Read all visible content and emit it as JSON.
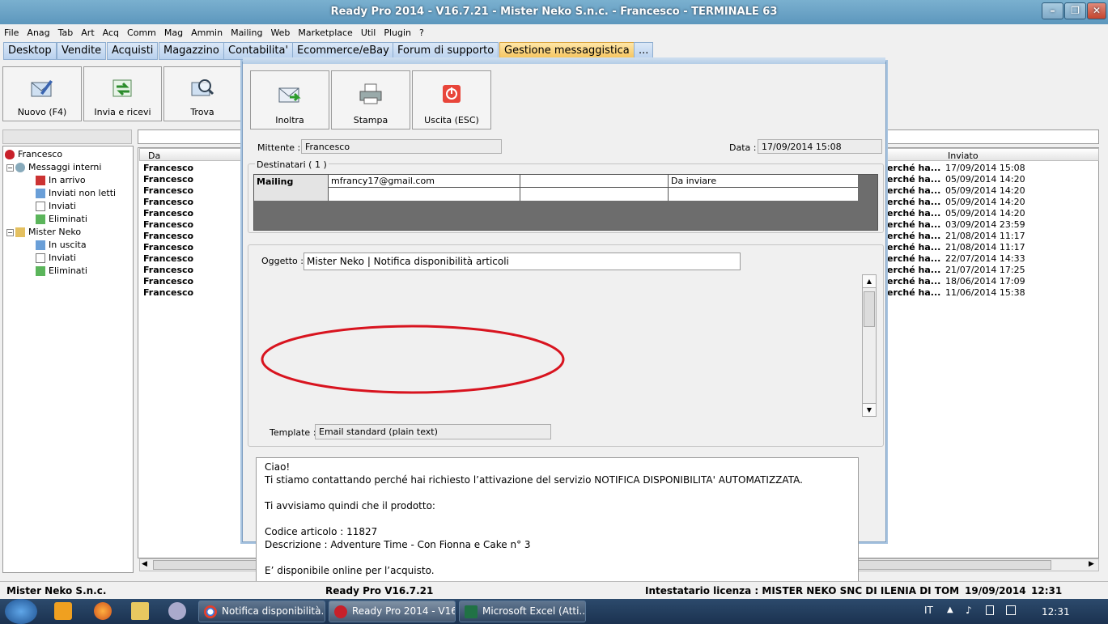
{
  "window": {
    "title": "Ready Pro 2014 - V16.7.21 - Mister Neko S.n.c. - Francesco - TERMINALE 63",
    "minimize": "–",
    "restore": "❐",
    "close": "✕"
  },
  "menu": [
    "File",
    "Anag",
    "Tab",
    "Art",
    "Acq",
    "Comm",
    "Mag",
    "Ammin",
    "Mailing",
    "Web",
    "Marketplace",
    "Util",
    "Plugin",
    "?"
  ],
  "tabs": [
    "Desktop",
    "Vendite",
    "Acquisti",
    "Magazzino",
    "Contabilita'",
    "Ecommerce/eBay",
    "Forum di supporto",
    "Gestione messaggistica",
    "..."
  ],
  "toolbar": {
    "new": "Nuovo (F4)",
    "sendreceive": "Invia e ricevi",
    "find": "Trova"
  },
  "tree": {
    "root": "Francesco",
    "internal": "Messaggi interni",
    "internal_items": [
      "In arrivo",
      "Inviati non letti",
      "Inviati",
      "Eliminati"
    ],
    "account": "Mister Neko",
    "account_items": [
      "In uscita",
      "Inviati",
      "Eliminati"
    ]
  },
  "list": {
    "col_from": "Da",
    "col_sent": "Inviato",
    "rows": [
      {
        "from": "Francesco",
        "subj": "erché ha...",
        "date": "17/09/2014 15:08"
      },
      {
        "from": "Francesco",
        "subj": "erché ha...",
        "date": "05/09/2014 14:20"
      },
      {
        "from": "Francesco",
        "subj": "erché ha...",
        "date": "05/09/2014 14:20"
      },
      {
        "from": "Francesco",
        "subj": "erché ha...",
        "date": "05/09/2014 14:20"
      },
      {
        "from": "Francesco",
        "subj": "erché ha...",
        "date": "05/09/2014 14:20"
      },
      {
        "from": "Francesco",
        "subj": "erché ha...",
        "date": "03/09/2014 23:59"
      },
      {
        "from": "Francesco",
        "subj": "erché ha...",
        "date": "21/08/2014 11:17"
      },
      {
        "from": "Francesco",
        "subj": "erché ha...",
        "date": "21/08/2014 11:17"
      },
      {
        "from": "Francesco",
        "subj": "erché ha...",
        "date": "22/07/2014 14:33"
      },
      {
        "from": "Francesco",
        "subj": "erché ha...",
        "date": "21/07/2014 17:25"
      },
      {
        "from": "Francesco",
        "subj": "erché ha...",
        "date": "18/06/2014 17:09"
      },
      {
        "from": "Francesco",
        "subj": "erché ha...",
        "date": "11/06/2014 15:38"
      }
    ]
  },
  "dialog": {
    "title": "",
    "buttons": {
      "forward": "Inoltra",
      "print": "Stampa",
      "exit": "Uscita (ESC)"
    },
    "sender_label": "Mittente :",
    "sender": "Francesco",
    "date_label": "Data :",
    "date": "17/09/2014 15:08",
    "recipients_label": "Destinatari ( 1 )",
    "recipient": {
      "type": "Mailing",
      "email": "mfrancy17@gmail.com",
      "status": "Da inviare"
    },
    "subject_label": "Oggetto :",
    "subject": "Mister Neko | Notifica disponibilità articoli",
    "body": [
      "Ciao!",
      "Ti stiamo contattando perché hai richiesto l’attivazione del servizio NOTIFICA DISPONIBILITA' AUTOMATIZZATA.",
      "",
      "Ti avvisiamo quindi che il prodotto:",
      "",
      "Codice articolo : 11827",
      "Descrizione : Adventure Time - Con Fionna e Cake n° 3",
      "",
      "E’ disponibile online per l’acquisto."
    ],
    "template_label": "Template :",
    "template": "Email standard (plain text)"
  },
  "status": {
    "company": "Mister Neko S.n.c.",
    "version": "Ready Pro V16.7.21",
    "license": "Intestatario licenza : MISTER NEKO SNC DI ILENIA DI TOMASO E I",
    "date": "19/09/2014",
    "time": "12:31"
  },
  "taskbar": {
    "apps": [
      "Notifica disponibilità...",
      "Ready Pro 2014 - V16...",
      "Microsoft Excel (Atti..."
    ],
    "lang": "IT",
    "clock": "12:31"
  },
  "colors": {
    "annotation": "#d8141f",
    "active_tab": "#f5c35a",
    "taskbar": "#1b3250"
  }
}
